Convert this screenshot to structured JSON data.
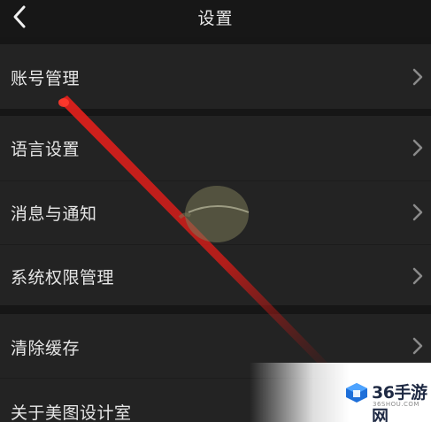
{
  "header": {
    "title": "设置",
    "back_icon": "chevron-left-icon"
  },
  "menu": {
    "items": [
      {
        "label": "账号管理",
        "icon": "chevron-right-icon"
      },
      {
        "label": "语言设置",
        "icon": "chevron-right-icon"
      },
      {
        "label": "消息与通知",
        "icon": "chevron-right-icon"
      },
      {
        "label": "系统权限管理",
        "icon": "chevron-right-icon"
      },
      {
        "label": "清除缓存",
        "icon": "chevron-right-icon"
      },
      {
        "label": "关于美图设计室",
        "icon": "chevron-right-icon"
      }
    ]
  },
  "watermark": {
    "brand_text": "36手游网",
    "brand_sub": "36SHOU.COM",
    "brand_color": "#1f2a44",
    "laser_color": "#e0201c"
  }
}
